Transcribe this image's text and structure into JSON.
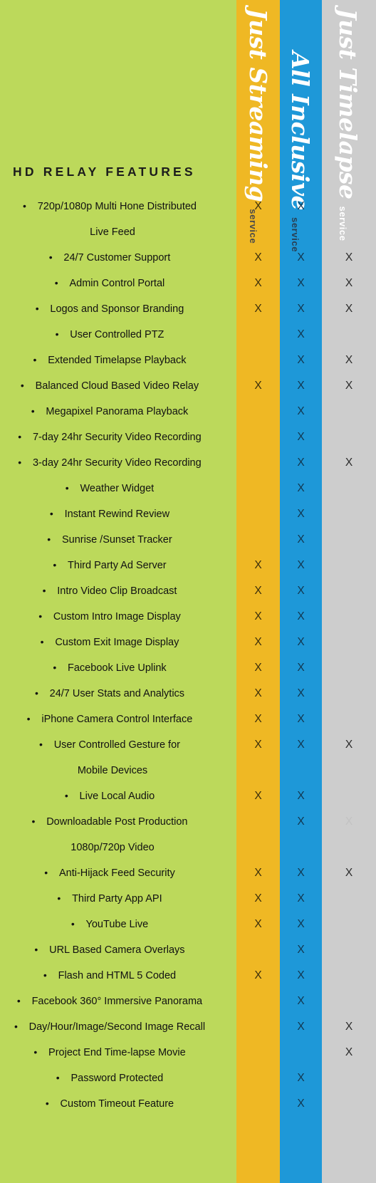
{
  "colors": {
    "features_bg": "#bcd95b",
    "streaming_bg": "#efb824",
    "inclusive_bg": "#1e98d8",
    "timelapse_bg": "#cdcdcd",
    "header_text": "#ffffff",
    "body_text": "#111111"
  },
  "section_title": "HD RELAY FEATURES",
  "columns": [
    {
      "id": "streaming",
      "brand": "Just Streaming",
      "sub": "service"
    },
    {
      "id": "inclusive",
      "brand": "All Inclusive",
      "sub": "service"
    },
    {
      "id": "timelapse",
      "brand": "Just Timelapse",
      "sub": "service"
    }
  ],
  "mark": "X",
  "rows": [
    {
      "label": "720p/1080p Multi Hone Distributed",
      "bullet": true,
      "streaming": "X",
      "inclusive": "X",
      "timelapse": ""
    },
    {
      "label": "Live Feed",
      "bullet": false,
      "streaming": "",
      "inclusive": "",
      "timelapse": ""
    },
    {
      "label": "24/7 Customer Support",
      "bullet": true,
      "streaming": "X",
      "inclusive": "X",
      "timelapse": "X"
    },
    {
      "label": "Admin Control Portal",
      "bullet": true,
      "streaming": "X",
      "inclusive": "X",
      "timelapse": "X"
    },
    {
      "label": "Logos and Sponsor Branding",
      "bullet": true,
      "streaming": "X",
      "inclusive": "X",
      "timelapse": "X"
    },
    {
      "label": "User Controlled PTZ",
      "bullet": true,
      "streaming": "",
      "inclusive": "X",
      "timelapse": ""
    },
    {
      "label": "Extended Timelapse Playback",
      "bullet": true,
      "streaming": "",
      "inclusive": "X",
      "timelapse": "X"
    },
    {
      "label": "Balanced Cloud Based Video Relay",
      "bullet": true,
      "streaming": "X",
      "inclusive": "X",
      "timelapse": "X"
    },
    {
      "label": "Megapixel Panorama Playback",
      "bullet": true,
      "streaming": "",
      "inclusive": "X",
      "timelapse": ""
    },
    {
      "label": "7-day 24hr Security Video Recording",
      "bullet": true,
      "streaming": "",
      "inclusive": "X",
      "timelapse": ""
    },
    {
      "label": "3-day 24hr Security Video Recording",
      "bullet": true,
      "streaming": "",
      "inclusive": "X",
      "timelapse": "X"
    },
    {
      "label": "Weather Widget",
      "bullet": true,
      "streaming": "",
      "inclusive": "X",
      "timelapse": ""
    },
    {
      "label": "Instant Rewind Review",
      "bullet": true,
      "streaming": "",
      "inclusive": "X",
      "timelapse": ""
    },
    {
      "label": "Sunrise /Sunset Tracker",
      "bullet": true,
      "streaming": "",
      "inclusive": "X",
      "timelapse": ""
    },
    {
      "label": "Third Party Ad Server",
      "bullet": true,
      "streaming": "X",
      "inclusive": "X",
      "timelapse": ""
    },
    {
      "label": "Intro Video Clip Broadcast",
      "bullet": true,
      "streaming": "X",
      "inclusive": "X",
      "timelapse": ""
    },
    {
      "label": "Custom Intro Image Display",
      "bullet": true,
      "streaming": "X",
      "inclusive": "X",
      "timelapse": ""
    },
    {
      "label": "Custom Exit Image Display",
      "bullet": true,
      "streaming": "X",
      "inclusive": "X",
      "timelapse": ""
    },
    {
      "label": "Facebook Live Uplink",
      "bullet": true,
      "streaming": "X",
      "inclusive": "X",
      "timelapse": ""
    },
    {
      "label": "24/7 User Stats and Analytics",
      "bullet": true,
      "streaming": "X",
      "inclusive": "X",
      "timelapse": ""
    },
    {
      "label": "iPhone Camera Control Interface",
      "bullet": true,
      "streaming": "X",
      "inclusive": "X",
      "timelapse": ""
    },
    {
      "label": "User Controlled Gesture for",
      "bullet": true,
      "streaming": "X",
      "inclusive": "X",
      "timelapse": "X"
    },
    {
      "label": "Mobile Devices",
      "bullet": false,
      "streaming": "",
      "inclusive": "",
      "timelapse": ""
    },
    {
      "label": "Live Local Audio",
      "bullet": true,
      "streaming": "X",
      "inclusive": "X",
      "timelapse": ""
    },
    {
      "label": "Downloadable Post Production",
      "bullet": true,
      "streaming": "",
      "inclusive": "X",
      "timelapse": "X",
      "timelapse_faint": true
    },
    {
      "label": "1080p/720p Video",
      "bullet": false,
      "streaming": "",
      "inclusive": "",
      "timelapse": ""
    },
    {
      "label": "Anti-Hijack Feed Security",
      "bullet": true,
      "streaming": "X",
      "inclusive": "X",
      "timelapse": "X"
    },
    {
      "label": "Third Party App API",
      "bullet": true,
      "streaming": "X",
      "inclusive": "X",
      "timelapse": ""
    },
    {
      "label": "YouTube Live",
      "bullet": true,
      "streaming": "X",
      "inclusive": "X",
      "timelapse": ""
    },
    {
      "label": "URL Based Camera Overlays",
      "bullet": true,
      "streaming": "",
      "inclusive": "X",
      "timelapse": ""
    },
    {
      "label": "Flash and HTML 5 Coded",
      "bullet": true,
      "streaming": "X",
      "inclusive": "X",
      "timelapse": ""
    },
    {
      "label": "Facebook 360° Immersive Panorama",
      "bullet": true,
      "streaming": "",
      "inclusive": "X",
      "timelapse": ""
    },
    {
      "label": "Day/Hour/Image/Second Image Recall",
      "bullet": true,
      "streaming": "",
      "inclusive": "X",
      "timelapse": "X"
    },
    {
      "label": "Project End Time-lapse Movie",
      "bullet": true,
      "streaming": "",
      "inclusive": "",
      "timelapse": "X"
    },
    {
      "label": "Password Protected",
      "bullet": true,
      "streaming": "",
      "inclusive": "X",
      "timelapse": ""
    },
    {
      "label": "Custom Timeout Feature",
      "bullet": true,
      "streaming": "",
      "inclusive": "X",
      "timelapse": ""
    }
  ]
}
